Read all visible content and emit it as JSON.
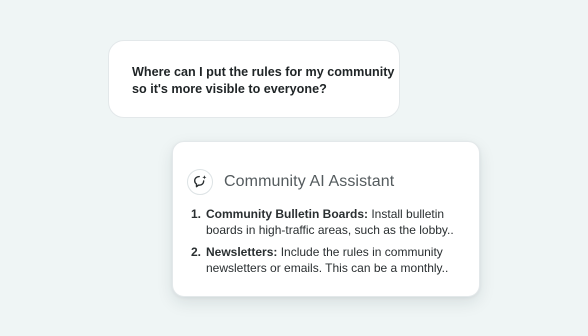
{
  "user_message": {
    "lines": [
      "Where can I put the rules for my community",
      "so it's more visible to everyone?"
    ]
  },
  "assistant": {
    "icon": "ai-chat-sparkle-icon",
    "title": "Community AI Assistant",
    "items": [
      {
        "number": "1.",
        "term": "Community Bulletin Boards:",
        "line1_rest": " Install bulletin",
        "line2": "boards in high-traffic areas, such as the lobby.."
      },
      {
        "number": "2.",
        "term": "Newsletters:",
        "line1_rest": " Include the rules in community",
        "line2": "newsletters or emails. This can be a monthly.."
      }
    ]
  },
  "colors": {
    "background": "#eff5f5",
    "card": "#ffffff",
    "text": "#1f2426",
    "muted_title": "#545b5e"
  }
}
